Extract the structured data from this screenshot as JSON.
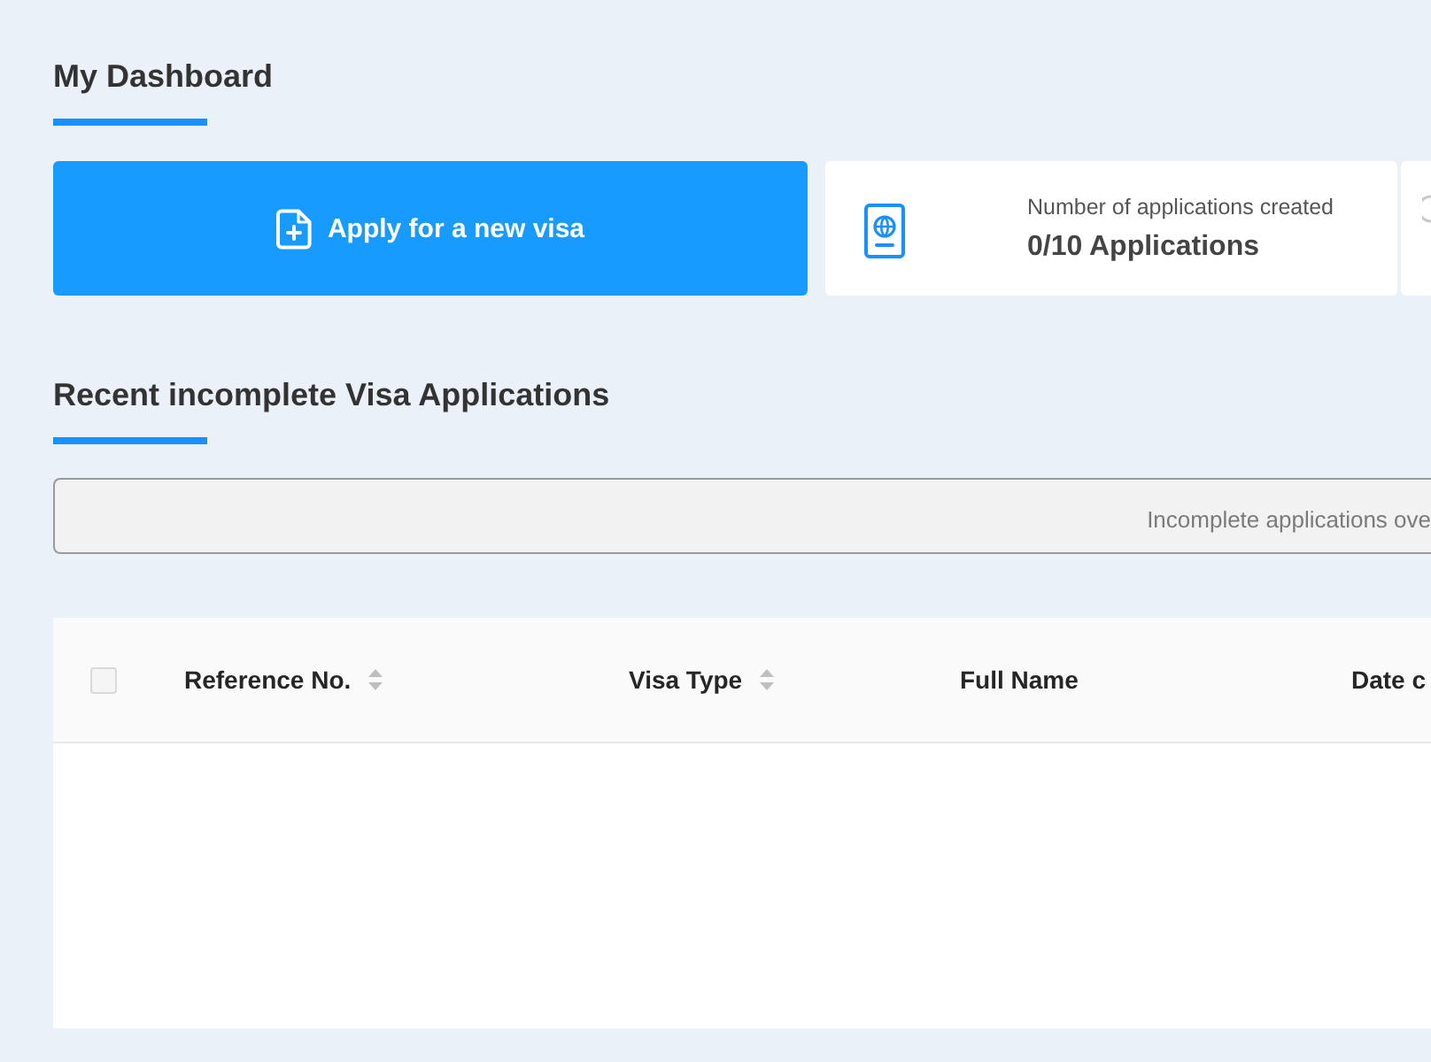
{
  "page_title": {
    "title": "My Dashboard"
  },
  "actions": {
    "apply_button": "Apply for a new visa"
  },
  "stats": [
    {
      "label": "Number of applications created",
      "value": "0/10 Applications"
    }
  ],
  "recent": {
    "title": "Recent incomplete Visa Applications",
    "notice": "Incomplete applications ove"
  },
  "table": {
    "select_all": {
      "checked": false
    },
    "columns": [
      {
        "label": "Reference No.",
        "sortable": true
      },
      {
        "label": "Visa Type",
        "sortable": true
      },
      {
        "label": "Full Name",
        "sortable": false
      },
      {
        "label": "Date c",
        "sortable": false
      }
    ]
  }
}
